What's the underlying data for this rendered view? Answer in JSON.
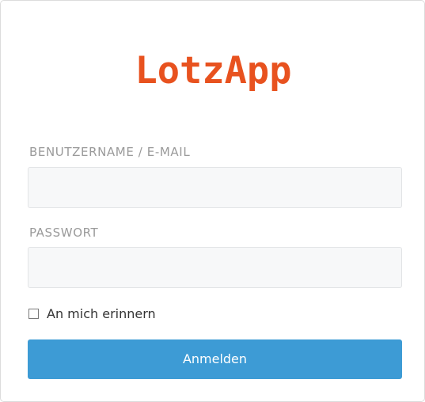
{
  "brand": {
    "logo_text": "LotzApp",
    "logo_color": "#e8521f"
  },
  "login": {
    "username_label": "BENUTZERNAME / E-MAIL",
    "username_value": "",
    "password_label": "PASSWORT",
    "password_value": "",
    "remember_label": "An mich erinnern",
    "remember_checked": false,
    "submit_label": "Anmelden",
    "submit_color": "#3d9bd5"
  }
}
